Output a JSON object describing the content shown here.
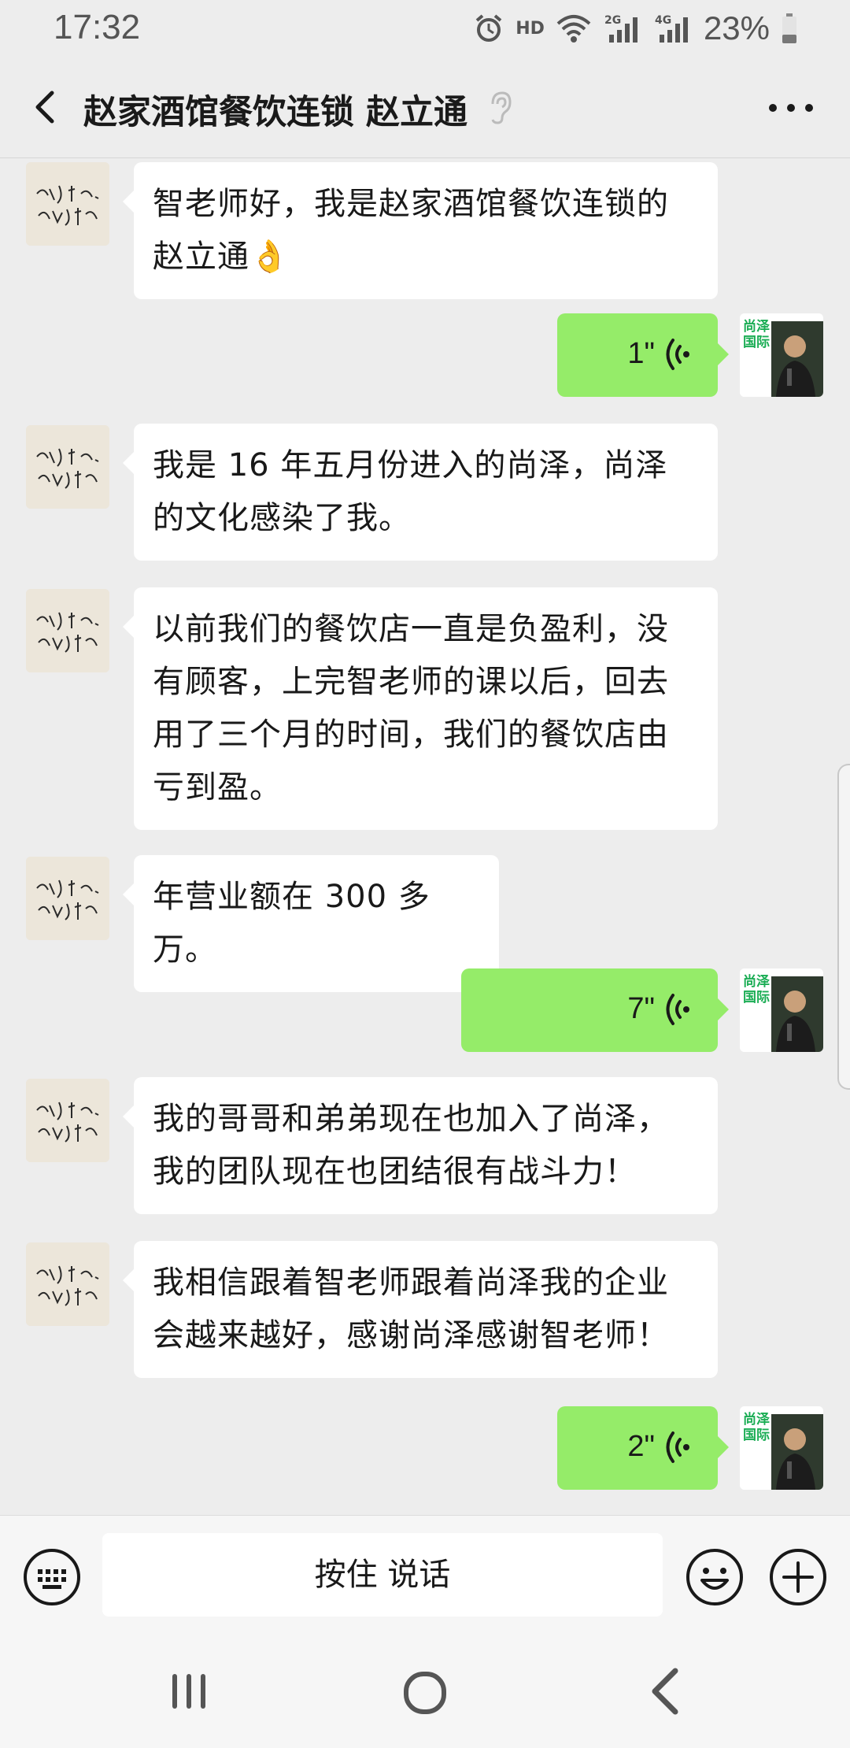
{
  "status_bar": {
    "time": "17:32",
    "hd": "HD",
    "network_2g": "2G",
    "network_4g": "4G",
    "battery": "23%"
  },
  "header": {
    "title": "赵家酒馆餐饮连锁 赵立通",
    "back_icon": "chevron-left-icon",
    "earpiece_icon": "ear-icon",
    "more_icon": "more-dots-icon"
  },
  "messages": [
    {
      "side": "left",
      "type": "text",
      "text": "智老师好，我是赵家酒馆餐饮连锁的赵立通👌"
    },
    {
      "side": "right",
      "type": "voice",
      "duration": "1\""
    },
    {
      "side": "left",
      "type": "text",
      "text": "我是 16 年五月份进入的尚泽，尚泽的文化感染了我。"
    },
    {
      "side": "left",
      "type": "text",
      "text": "以前我们的餐饮店一直是负盈利，没有顾客，上完智老师的课以后，回去用了三个月的时间，我们的餐饮店由亏到盈。"
    },
    {
      "side": "left",
      "type": "text",
      "text": "年营业额在 300 多万。"
    },
    {
      "side": "right",
      "type": "voice",
      "duration": "7\""
    },
    {
      "side": "left",
      "type": "text",
      "text": "我的哥哥和弟弟现在也加入了尚泽，我的团队现在也团结很有战斗力！"
    },
    {
      "side": "left",
      "type": "text",
      "text": "我相信跟着智老师跟着尚泽我的企业会越来越好，感谢尚泽感谢智老师！"
    },
    {
      "side": "right",
      "type": "voice",
      "duration": "2\""
    }
  ],
  "my_avatar": {
    "brand_text": "尚泽国际"
  },
  "input_bar": {
    "hold_to_talk": "按住 说话",
    "keyboard_icon": "keyboard-icon",
    "emoji_icon": "emoji-icon",
    "plus_icon": "plus-icon"
  },
  "colors": {
    "background": "#ededed",
    "my_bubble": "#95ec69",
    "their_bubble": "#ffffff",
    "brand_green": "#1aad54"
  }
}
